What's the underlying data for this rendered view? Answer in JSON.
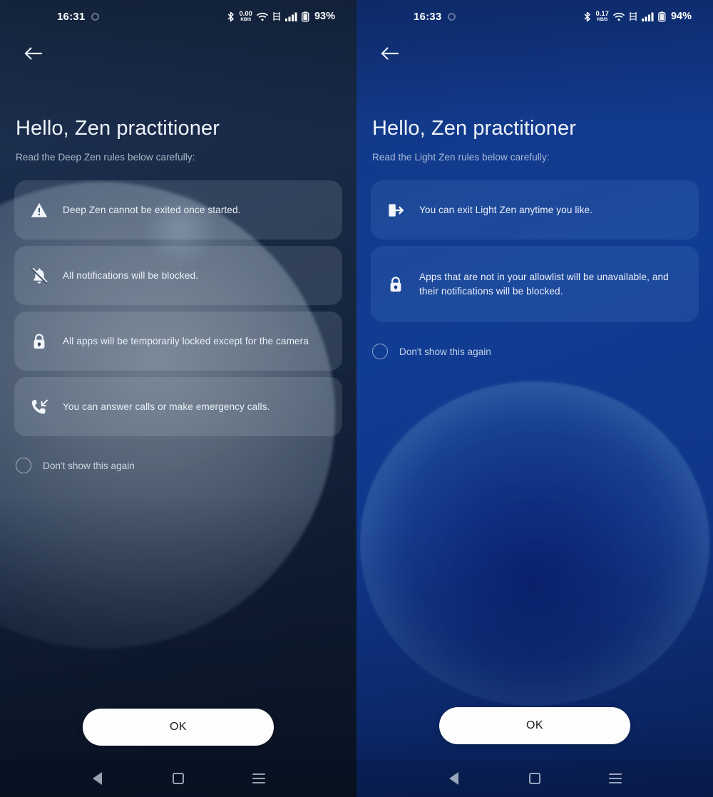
{
  "left": {
    "theme_name": "Deep Zen",
    "status": {
      "time": "16:31",
      "alarm_icon": "alarm-icon",
      "bluetooth_icon": "bluetooth-icon",
      "net_speed_value": "0.00",
      "net_speed_unit": "KB/S",
      "wifi_icon": "wifi-icon",
      "nfc_icon": "nfc-icon",
      "signal_icon": "signal-bars-icon",
      "battery_icon": "battery-icon",
      "battery": "93%"
    },
    "back_icon": "back-arrow-icon",
    "title": "Hello, Zen practitioner",
    "subtitle": "Read the Deep Zen rules below carefully:",
    "rules": [
      {
        "icon": "warning-triangle-icon",
        "text": "Deep Zen cannot be exited once started."
      },
      {
        "icon": "bell-off-icon",
        "text": "All notifications will be blocked."
      },
      {
        "icon": "lock-icon",
        "text": "All apps will be temporarily locked except for the camera"
      },
      {
        "icon": "incoming-call-icon",
        "text": "You can answer calls or make emergency calls."
      }
    ],
    "checkbox_label": "Don't show this again",
    "checkbox_checked": false,
    "ok_label": "OK"
  },
  "right": {
    "theme_name": "Light Zen",
    "status": {
      "time": "16:33",
      "alarm_icon": "alarm-icon",
      "bluetooth_icon": "bluetooth-icon",
      "net_speed_value": "0.17",
      "net_speed_unit": "KB/S",
      "wifi_icon": "wifi-icon",
      "nfc_icon": "nfc-icon",
      "signal_icon": "signal-bars-icon",
      "battery_icon": "battery-icon",
      "battery": "94%"
    },
    "back_icon": "back-arrow-icon",
    "title": "Hello, Zen practitioner",
    "subtitle": "Read the Light Zen rules below carefully:",
    "rules": [
      {
        "icon": "exit-icon",
        "text": "You can exit Light Zen anytime you like."
      },
      {
        "icon": "lock-icon",
        "text": "Apps that are not in your allowlist will be unavailable, and their notifications will be blocked."
      }
    ],
    "checkbox_label": "Don't show this again",
    "checkbox_checked": false,
    "ok_label": "OK"
  },
  "navbar": {
    "back_icon": "nav-back-triangle-icon",
    "home_icon": "nav-home-square-icon",
    "recents_icon": "nav-menu-icon"
  },
  "colors": {
    "left_bg_top": "#1e3252",
    "left_bg_bottom": "#0c1729",
    "right_bg_top": "#12357e",
    "right_bg_bottom": "#0b2764",
    "button_bg": "#fdfdfd",
    "button_text": "#1b1b1b",
    "text_primary": "#eaf1f8"
  }
}
